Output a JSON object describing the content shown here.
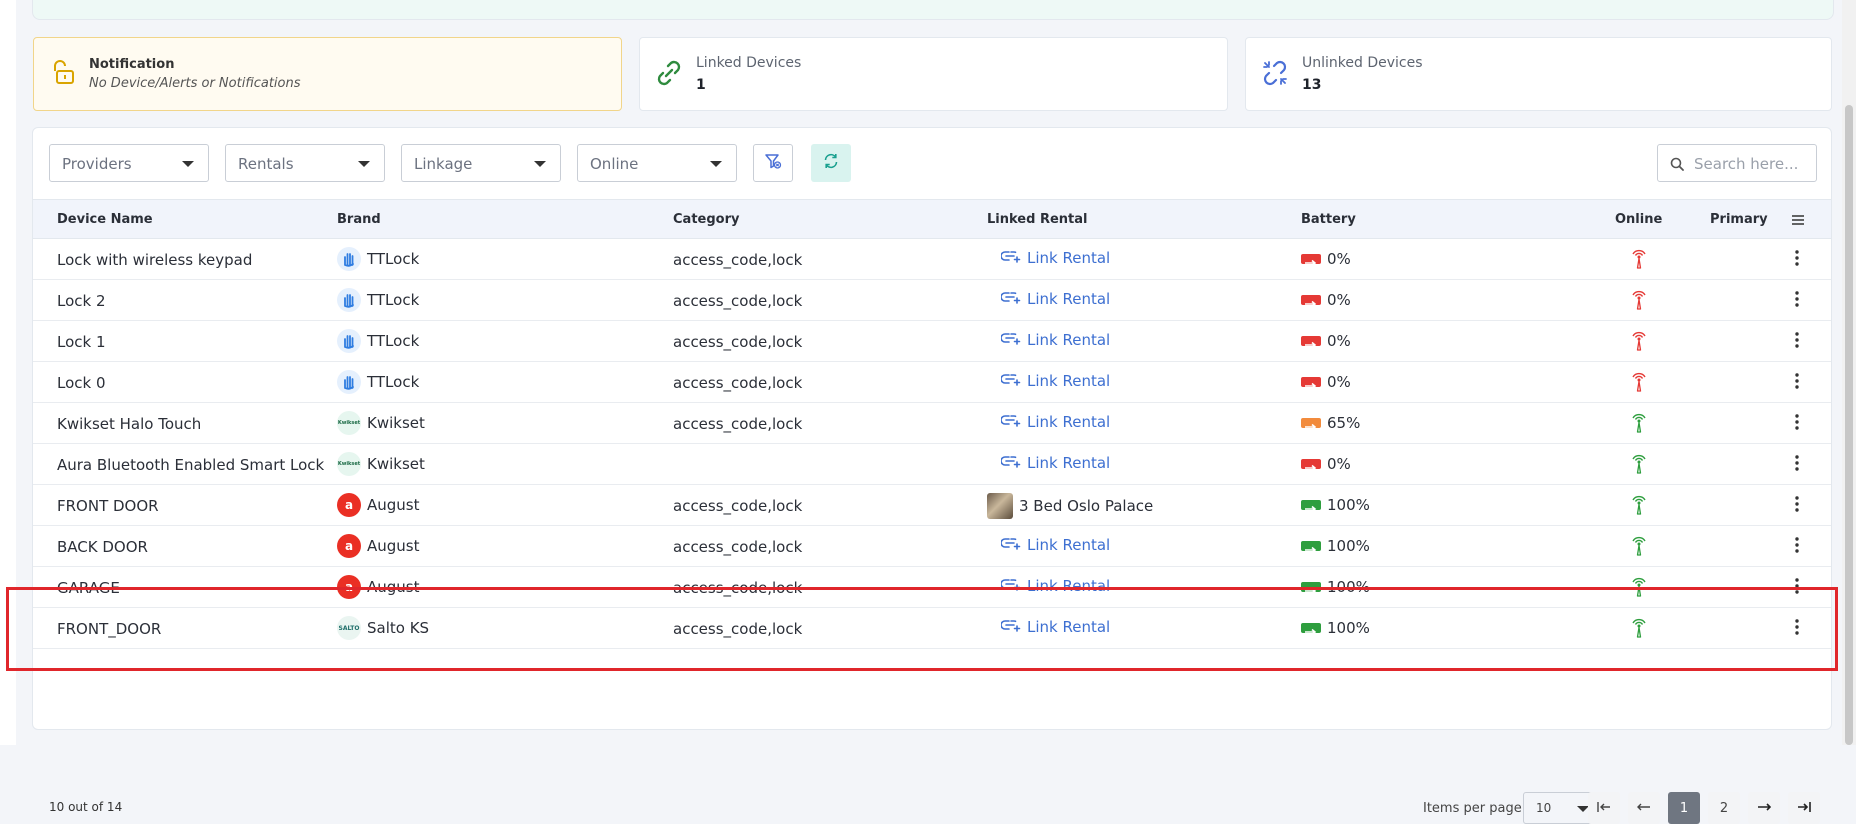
{
  "cards": {
    "notification": {
      "title": "Notification",
      "message": "No Device/Alerts or Notifications"
    },
    "linked": {
      "title": "Linked Devices",
      "count": "1"
    },
    "unlinked": {
      "title": "Unlinked Devices",
      "count": "13"
    }
  },
  "filters": {
    "providers": "Providers",
    "rentals": "Rentals",
    "linkage": "Linkage",
    "online": "Online",
    "search_placeholder": "Search here..."
  },
  "table": {
    "columns": [
      "Device Name",
      "Brand",
      "Category",
      "Linked Rental",
      "Battery",
      "Online",
      "Primary"
    ],
    "rows": [
      {
        "name": "Lock with wireless keypad",
        "brand": "TTLock",
        "brand_icon": "ttlock-logo",
        "category": "access_code,lock",
        "rental": "Link Rental",
        "rental_linked": false,
        "battery": "0%",
        "battery_color": "#e53935",
        "online": false
      },
      {
        "name": "Lock 2",
        "brand": "TTLock",
        "brand_icon": "ttlock-logo",
        "category": "access_code,lock",
        "rental": "Link Rental",
        "rental_linked": false,
        "battery": "0%",
        "battery_color": "#e53935",
        "online": false
      },
      {
        "name": "Lock 1",
        "brand": "TTLock",
        "brand_icon": "ttlock-logo",
        "category": "access_code,lock",
        "rental": "Link Rental",
        "rental_linked": false,
        "battery": "0%",
        "battery_color": "#e53935",
        "online": false
      },
      {
        "name": "Lock 0",
        "brand": "TTLock",
        "brand_icon": "ttlock-logo",
        "category": "access_code,lock",
        "rental": "Link Rental",
        "rental_linked": false,
        "battery": "0%",
        "battery_color": "#e53935",
        "online": false
      },
      {
        "name": "Kwikset Halo Touch",
        "brand": "Kwikset",
        "brand_icon": "kwikset-logo",
        "category": "access_code,lock",
        "rental": "Link Rental",
        "rental_linked": false,
        "battery": "65%",
        "battery_color": "#f28b3c",
        "online": true
      },
      {
        "name": "Aura Bluetooth Enabled Smart Lock",
        "brand": "Kwikset",
        "brand_icon": "kwikset-logo",
        "category": "",
        "rental": "Link Rental",
        "rental_linked": false,
        "battery": "0%",
        "battery_color": "#e53935",
        "online": true
      },
      {
        "name": "FRONT DOOR",
        "brand": "August",
        "brand_icon": "august-logo",
        "category": "access_code,lock",
        "rental": "3 Bed Oslo Palace",
        "rental_linked": true,
        "battery": "100%",
        "battery_color": "#2e9e3e",
        "online": true
      },
      {
        "name": "BACK DOOR",
        "brand": "August",
        "brand_icon": "august-logo",
        "category": "access_code,lock",
        "rental": "Link Rental",
        "rental_linked": false,
        "battery": "100%",
        "battery_color": "#2e9e3e",
        "online": true
      },
      {
        "name": "GARAGE",
        "brand": "August",
        "brand_icon": "august-logo",
        "category": "access_code,lock",
        "rental": "Link Rental",
        "rental_linked": false,
        "battery": "100%",
        "battery_color": "#2e9e3e",
        "online": true
      },
      {
        "name": "FRONT_DOOR",
        "brand": "Salto KS",
        "brand_icon": "salto-logo",
        "category": "access_code,lock",
        "rental": "Link Rental",
        "rental_linked": false,
        "battery": "100%",
        "battery_color": "#2e9e3e",
        "online": true
      }
    ]
  },
  "footer": {
    "summary": "10 out of 14",
    "items_per_page_label": "Items per page",
    "items_per_page": "10",
    "pages": [
      "1",
      "2"
    ],
    "current_page": "1"
  },
  "colors": {
    "accent": "#3d6fd1",
    "online": "#2e9e3e",
    "offline": "#e53935",
    "highlight": "#e0262b"
  },
  "brand_logo_text": {
    "kwikset": "Kwikset",
    "august": "a",
    "salto": "SALTO"
  }
}
